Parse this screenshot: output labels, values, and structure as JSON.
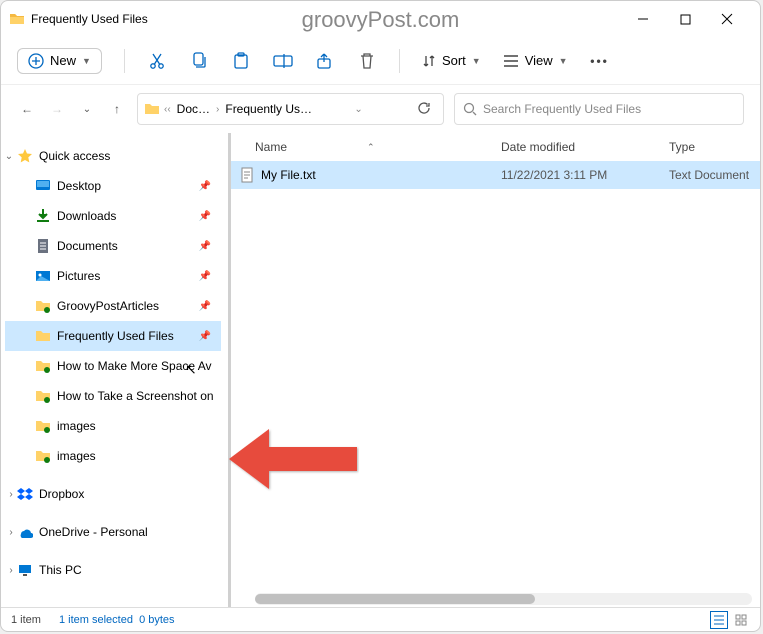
{
  "titlebar": {
    "title": "Frequently Used Files"
  },
  "watermark": "groovyPost.com",
  "toolbar": {
    "new_label": "New",
    "sort_label": "Sort",
    "view_label": "View"
  },
  "breadcrumb": {
    "seg1": "Doc…",
    "seg2": "Frequently Us…"
  },
  "search": {
    "placeholder": "Search Frequently Used Files"
  },
  "nav": {
    "quick_access": "Quick access",
    "items": [
      {
        "label": "Desktop",
        "pinned": true
      },
      {
        "label": "Downloads",
        "pinned": true
      },
      {
        "label": "Documents",
        "pinned": true
      },
      {
        "label": "Pictures",
        "pinned": true
      },
      {
        "label": "GroovyPostArticles",
        "pinned": true
      },
      {
        "label": "Frequently Used Files",
        "pinned": true,
        "selected": true
      },
      {
        "label": "How to Make More Space Av"
      },
      {
        "label": "How to Take a Screenshot on"
      },
      {
        "label": "images"
      },
      {
        "label": "images"
      }
    ],
    "dropbox": "Dropbox",
    "onedrive": "OneDrive - Personal",
    "this_pc": "This PC"
  },
  "columns": {
    "name": "Name",
    "date": "Date modified",
    "type": "Type"
  },
  "files": [
    {
      "name": "My File.txt",
      "date": "11/22/2021 3:11 PM",
      "type": "Text Document"
    }
  ],
  "status": {
    "count": "1 item",
    "selected": "1 item selected",
    "size": "0 bytes"
  }
}
